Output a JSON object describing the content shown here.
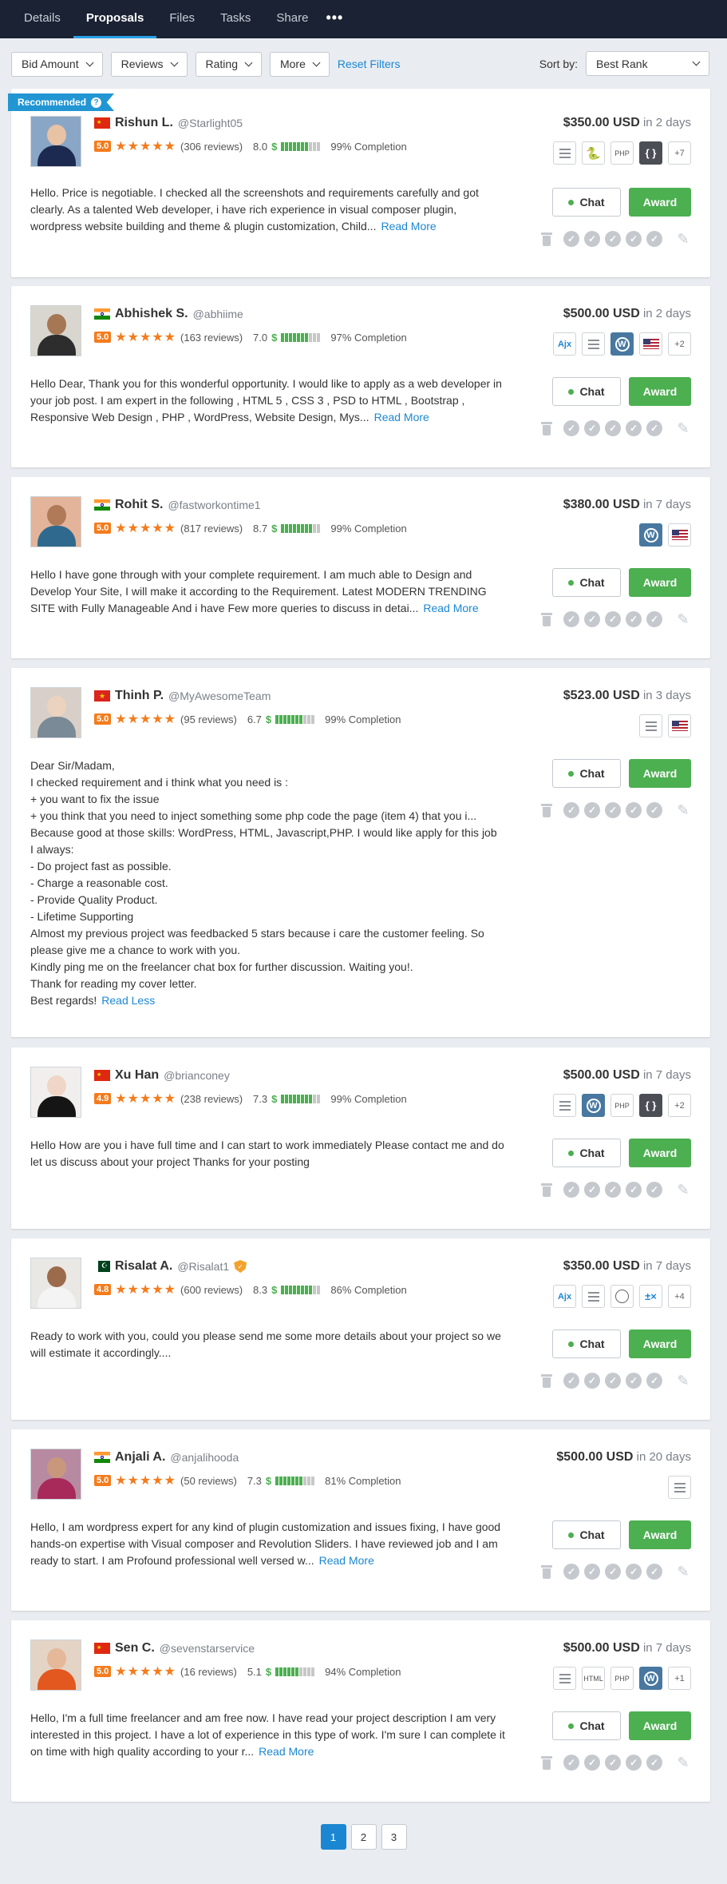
{
  "tabs": [
    {
      "label": "Details",
      "active": false
    },
    {
      "label": "Proposals",
      "active": true
    },
    {
      "label": "Files",
      "active": false
    },
    {
      "label": "Tasks",
      "active": false
    },
    {
      "label": "Share",
      "active": false
    }
  ],
  "more_tabs": "•••",
  "filters": {
    "bid_amount": "Bid Amount",
    "reviews": "Reviews",
    "rating": "Rating",
    "more": "More",
    "reset": "Reset Filters",
    "sort_label": "Sort by:",
    "sort_value": "Best Rank"
  },
  "recommended_label": "Recommended",
  "buttons": {
    "chat": "Chat",
    "award": "Award"
  },
  "proposals": [
    {
      "name": "Rishun L.",
      "handle": "@Starlight05",
      "country": "cn",
      "rating": "5.0",
      "reviews": "(306 reviews)",
      "earnings": "8.0",
      "earnings_level": 7,
      "completion": "99% Completion",
      "price": "$350.00 USD",
      "duration": "in 2 days",
      "skills": [
        "list",
        "python",
        "php",
        "code"
      ],
      "more_skills": "+7",
      "recommended": true,
      "description": "Hello. Price is negotiable. I checked all the screenshots and requirements carefully and got clearly. As a talented Web developer, i have rich experience in visual composer plugin, wordpress website building and theme & plugin customization, Child...",
      "link": "Read More",
      "avatar": {
        "bg": "#8aa6c6",
        "skin": "#e7c2a4",
        "body": "#1c2a52"
      }
    },
    {
      "name": "Abhishek S.",
      "handle": "@abhiime",
      "country": "in",
      "rating": "5.0",
      "reviews": "(163 reviews)",
      "earnings": "7.0",
      "earnings_level": 7,
      "completion": "97% Completion",
      "price": "$500.00 USD",
      "duration": "in 2 days",
      "skills": [
        "ajax",
        "list",
        "wp",
        "us"
      ],
      "more_skills": "+2",
      "recommended": false,
      "description": "Hello Dear, Thank you for this wonderful opportunity. I would like to apply as a web developer in your job post. I am expert in the following , HTML 5 , CSS 3 , PSD to HTML , Bootstrap , Responsive Web Design , PHP , WordPress, Website Design, Mys...",
      "link": "Read More",
      "avatar": {
        "bg": "#d9d6cf",
        "skin": "#a57755",
        "body": "#2d2d2d"
      }
    },
    {
      "name": "Rohit S.",
      "handle": "@fastworkontime1",
      "country": "in",
      "rating": "5.0",
      "reviews": "(817 reviews)",
      "earnings": "8.7",
      "earnings_level": 8,
      "completion": "99% Completion",
      "price": "$380.00 USD",
      "duration": "in 7 days",
      "skills": [
        "wp",
        "us"
      ],
      "more_skills": "",
      "recommended": false,
      "description": "Hello I have gone through with your complete requirement. I am much able to Design and Develop Your Site, I will make it according to the Requirement. Latest MODERN TRENDING SITE with Fully Manageable And i have Few more queries to discuss in detai...",
      "link": "Read More",
      "avatar": {
        "bg": "#e3b49a",
        "skin": "#b07a58",
        "body": "#2f6a8e"
      }
    },
    {
      "name": "Thinh P.",
      "handle": "@MyAwesomeTeam",
      "country": "vn",
      "rating": "5.0",
      "reviews": "(95 reviews)",
      "earnings": "6.7",
      "earnings_level": 7,
      "completion": "99% Completion",
      "price": "$523.00 USD",
      "duration": "in 3 days",
      "skills": [
        "list",
        "us"
      ],
      "more_skills": "",
      "recommended": false,
      "description_lines": [
        "Dear Sir/Madam,",
        "I checked requirement and i think what you need is :",
        "+ you want to fix the issue",
        "+ you think that you need to inject something some php code the page (item 4) that you i...",
        "Because good at those skills: WordPress, HTML, Javascript,PHP. I would like apply for this job",
        "I always:",
        "- Do project fast as possible.",
        "- Charge a reasonable cost.",
        "- Provide Quality Product.",
        "- Lifetime Supporting",
        "Almost my previous project was feedbacked 5 stars because i care the customer feeling. So please give me a chance to work with you.",
        "Kindly ping me on the freelancer chat box for further discussion. Waiting you!.",
        "Thank for reading my cover letter.",
        "Best regards!"
      ],
      "link": "Read Less",
      "avatar": {
        "bg": "#d8d0c8",
        "skin": "#ecd3bf",
        "body": "#7a8a96"
      }
    },
    {
      "name": "Xu Han",
      "handle": "@brianconey",
      "country": "cn",
      "rating": "4.9",
      "reviews": "(238 reviews)",
      "earnings": "7.3",
      "earnings_level": 8,
      "completion": "99% Completion",
      "price": "$500.00 USD",
      "duration": "in 7 days",
      "skills": [
        "list",
        "wp",
        "php",
        "code"
      ],
      "more_skills": "+2",
      "recommended": false,
      "description": "Hello How are you i have full time and I can start to work immediately Please contact me and do let us discuss about your project Thanks for your posting",
      "link": "",
      "avatar": {
        "bg": "#f1efee",
        "skin": "#efd6c6",
        "body": "#151515"
      }
    },
    {
      "name": "Risalat A.",
      "handle": "@Risalat1",
      "country": "pk",
      "verified": true,
      "rating": "4.8",
      "reviews": "(600 reviews)",
      "earnings": "8.3",
      "earnings_level": 8,
      "completion": "86% Completion",
      "price": "$350.00 USD",
      "duration": "in 7 days",
      "skills": [
        "ajax",
        "list",
        "safari",
        "math"
      ],
      "more_skills": "+4",
      "recommended": false,
      "description": "Ready to work with you, could you please send me some more details about your project so we will estimate it accordingly....",
      "link": "",
      "avatar": {
        "bg": "#e9e8e4",
        "skin": "#9c6b4c",
        "body": "#f4f4f4"
      }
    },
    {
      "name": "Anjali A.",
      "handle": "@anjalihooda",
      "country": "in",
      "rating": "5.0",
      "reviews": "(50 reviews)",
      "earnings": "7.3",
      "earnings_level": 7,
      "completion": "81% Completion",
      "price": "$500.00 USD",
      "duration": "in 20 days",
      "skills": [
        "list"
      ],
      "more_skills": "",
      "recommended": false,
      "description": "Hello, I am wordpress expert for any kind of plugin customization and issues fixing, I have good hands-on expertise with Visual composer and Revolution Sliders. I have reviewed job and I am ready to start. I am Profound professional well versed w...",
      "link": "Read More",
      "avatar": {
        "bg": "#b88aa2",
        "skin": "#c9977c",
        "body": "#a82a5a"
      }
    },
    {
      "name": "Sen C.",
      "handle": "@sevenstarservice",
      "country": "cn",
      "rating": "5.0",
      "reviews": "(16 reviews)",
      "earnings": "5.1",
      "earnings_level": 6,
      "completion": "94% Completion",
      "price": "$500.00 USD",
      "duration": "in 7 days",
      "skills": [
        "list",
        "html",
        "php",
        "wp"
      ],
      "more_skills": "+1",
      "recommended": false,
      "description": "Hello, I'm a full time freelancer and am free now. I have read your project description I am very interested in this project. I have a lot of experience in this type of work. I'm sure I can complete it on time with high quality according to your r...",
      "link": "Read More",
      "avatar": {
        "bg": "#e4d4c6",
        "skin": "#e4b898",
        "body": "#e2581f"
      }
    }
  ],
  "pagination": [
    "1",
    "2",
    "3"
  ],
  "colors": {
    "accent": "#1b87d2",
    "award": "#4caf50",
    "star": "#f47c1c",
    "nav": "#1a2233"
  }
}
